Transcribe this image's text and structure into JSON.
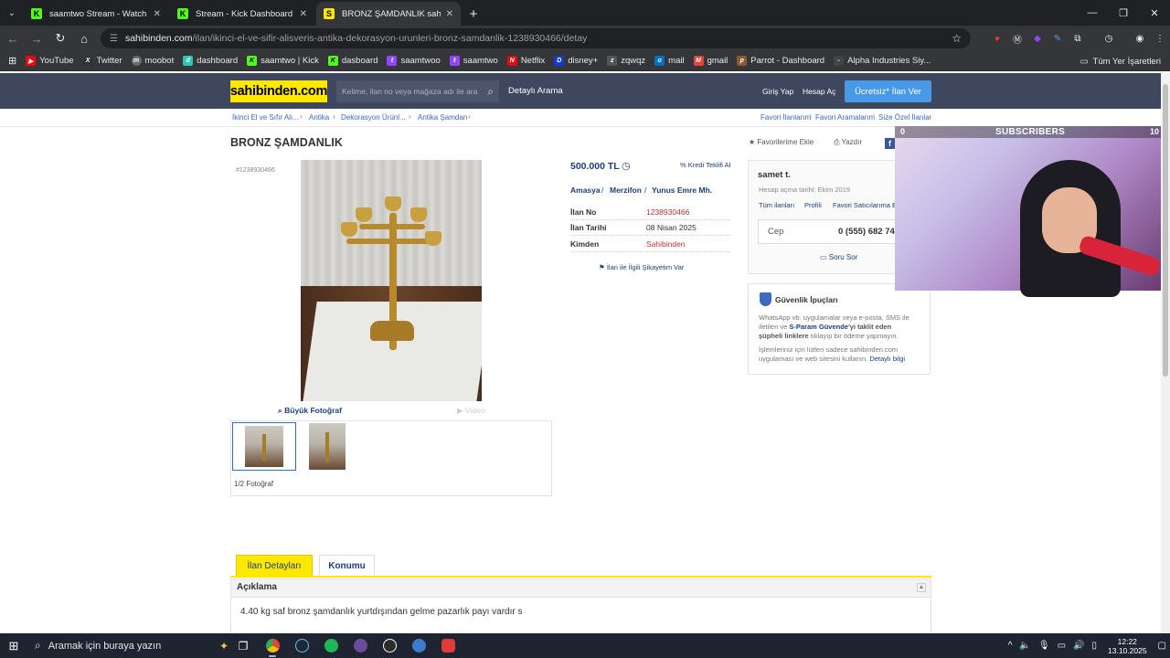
{
  "browser": {
    "tabs": [
      {
        "title": "saamtwo Stream - Watch Live o",
        "favicon_color": "#53fc18",
        "favicon_letter": "K",
        "active": false
      },
      {
        "title": "Stream - Kick Dashboard",
        "favicon_color": "#53fc18",
        "favicon_letter": "K",
        "active": false
      },
      {
        "title": "BRONZ ŞAMDANLIK sahibinden",
        "favicon_color": "#ffe800",
        "favicon_letter": "S",
        "active": true
      }
    ],
    "url_host": "sahibinden.com",
    "url_path": "/ilan/ikinci-el-ve-sifir-alisveris-antika-dekorasyon-urunleri-bronz-samdanlik-1238930466/detay",
    "bookmarks": [
      {
        "label": "YouTube",
        "color": "#ff0000"
      },
      {
        "label": "Twitter",
        "color": "#333333"
      },
      {
        "label": "moobot",
        "color": "#6b6b6b"
      },
      {
        "label": "dashboard",
        "color": "#2ec4b6"
      },
      {
        "label": "saamtwo | Kick",
        "color": "#53fc18"
      },
      {
        "label": "dasboard",
        "color": "#53fc18"
      },
      {
        "label": "saamtwoo",
        "color": "#9146ff"
      },
      {
        "label": "saamtwo",
        "color": "#9146ff"
      },
      {
        "label": "Netflix",
        "color": "#e50914"
      },
      {
        "label": "disney+",
        "color": "#113ccf"
      },
      {
        "label": "zqwqz",
        "color": "#555555"
      },
      {
        "label": "mail",
        "color": "#0072c6"
      },
      {
        "label": "gmail",
        "color": "#ea4335"
      },
      {
        "label": "Parrot - Dashboard",
        "color": "#8b5a2b"
      },
      {
        "label": "Alpha Industries Siy...",
        "color": "#444444"
      }
    ],
    "all_bookmarks": "Tüm Yer İşaretleri"
  },
  "site": {
    "logo": "sahibinden.com",
    "search_placeholder": "Kelime, ilan no veya mağaza adı ile ara",
    "detailed_search": "Detaylı Arama",
    "login": "Giriş Yap",
    "register": "Hesap Aç",
    "post_ad": "Ücretsiz* İlan Ver",
    "breadcrumbs": [
      "İkinci El ve Sıfır Alı...",
      "Antika",
      "Dekorasyon Ürünl...",
      "Antika Şamdan"
    ],
    "right_links": [
      "Favori İlanlarım",
      "Favori Aramalarım",
      "Size Özel İlanlar"
    ]
  },
  "listing": {
    "title": "BRONZ ŞAMDANLIK",
    "add_favorite": "Favorilerime Ekle",
    "print": "Yazdır",
    "id_small": "#1238930466",
    "big_photo": "Büyük Fotoğraf",
    "video": "Video",
    "photo_count": "1/2 Fotoğraf",
    "price": "500.000 TL",
    "credit_offer": "Kredi Teklifi Al",
    "location": [
      "Amasya",
      "Merzifon",
      "Yunus Emre Mh."
    ],
    "details": [
      {
        "label": "İlan No",
        "value": "1238930466",
        "red": true
      },
      {
        "label": "İlan Tarihi",
        "value": "08 Nisan 2025",
        "red": false
      },
      {
        "label": "Kimden",
        "value": "Sahibinden",
        "red": true
      }
    ],
    "complaint": "İlan ile İlgili Şikayetim Var"
  },
  "seller": {
    "name": "samet t.",
    "since": "Hesap açma tarihi: Ekim 2019",
    "links": [
      "Tüm ilanları",
      "Profili",
      "Favori Satıcılarıma E"
    ],
    "phone_label": "Cep",
    "phone": "0 (555) 682 74",
    "ask": "Soru Sor"
  },
  "safety": {
    "title": "Güvenlik İpuçları",
    "line1": "WhatsApp vb. uygulamalar veya e-posta, SMS ile",
    "line2a": "iletilen ve ",
    "line2b": "S-Param Güvende",
    "line2c": "'yi taklit eden",
    "line3a": "şüpheli linklere",
    "line3b": " tıklayıp bir ödeme yapmayın.",
    "line4": "İşlemleriniz için lütfen sadece sahibinden.com",
    "line5a": "uygulaması ve web sitesini kullanın. ",
    "line5b": "Detaylı bilgi"
  },
  "overlay": {
    "sub_left": "0",
    "sub_title": "SUBSCRIBERS",
    "sub_right": "10"
  },
  "details_section": {
    "tab_details": "İlan Detayları",
    "tab_location": "Konumu",
    "desc_title": "Açıklama",
    "desc_text": "4.40 kg saf bronz şamdanlık yurtdışından gelme pazarlık payı vardır s"
  },
  "taskbar": {
    "search": "Aramak için buraya yazın",
    "time": "12:22",
    "date": "13.10.2025"
  }
}
